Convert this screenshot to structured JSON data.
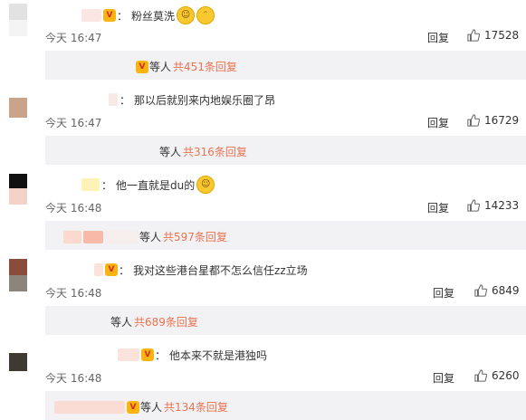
{
  "comments": [
    {
      "text": "粉丝莫洗",
      "emojis": [
        "smirk-emoji",
        "cat-emoji"
      ],
      "time": "今天 16:47",
      "reply_label": "回复",
      "likes": "17528",
      "thread_prefix": "等人",
      "thread_count": "共451条回复",
      "avatar_colors": [
        "#dddddd",
        "#cfcfcf"
      ]
    },
    {
      "text": "那以后就别来内地娱乐圈了昂",
      "emojis": [],
      "time": "今天 16:47",
      "reply_label": "回复",
      "likes": "16729",
      "thread_prefix": "等人",
      "thread_count": "共316条回复",
      "avatar_colors": [
        "#c9a48a",
        "#d8b8a2"
      ]
    },
    {
      "text": "他一直就是du的",
      "emojis": [
        "smile-emoji"
      ],
      "time": "今天 16:48",
      "reply_label": "回复",
      "likes": "14233",
      "thread_prefix": "等人",
      "thread_count": "共597条回复",
      "avatar_colors": [
        "#111111",
        "#f3d2c8"
      ]
    },
    {
      "text": "我对这些港台星都不怎么信任zz立场",
      "emojis": [],
      "time": "今天 16:48",
      "reply_label": "回复",
      "likes": "6849",
      "thread_prefix": "等人",
      "thread_count": "共689条回复",
      "avatar_colors": [
        "#8a4d3c",
        "#8c857c"
      ]
    },
    {
      "text": "他本来不就是港独吗",
      "emojis": [],
      "time": "今天 16:48",
      "reply_label": "回复",
      "likes": "6260",
      "thread_prefix": "等人",
      "thread_count": "共134条回复",
      "avatar_colors": [
        "#3e3a33",
        "#6a6455"
      ]
    }
  ],
  "colors": {
    "accent": "#eb7350",
    "reply_bg": "#f2f2f5",
    "vip": "#f7b512"
  }
}
